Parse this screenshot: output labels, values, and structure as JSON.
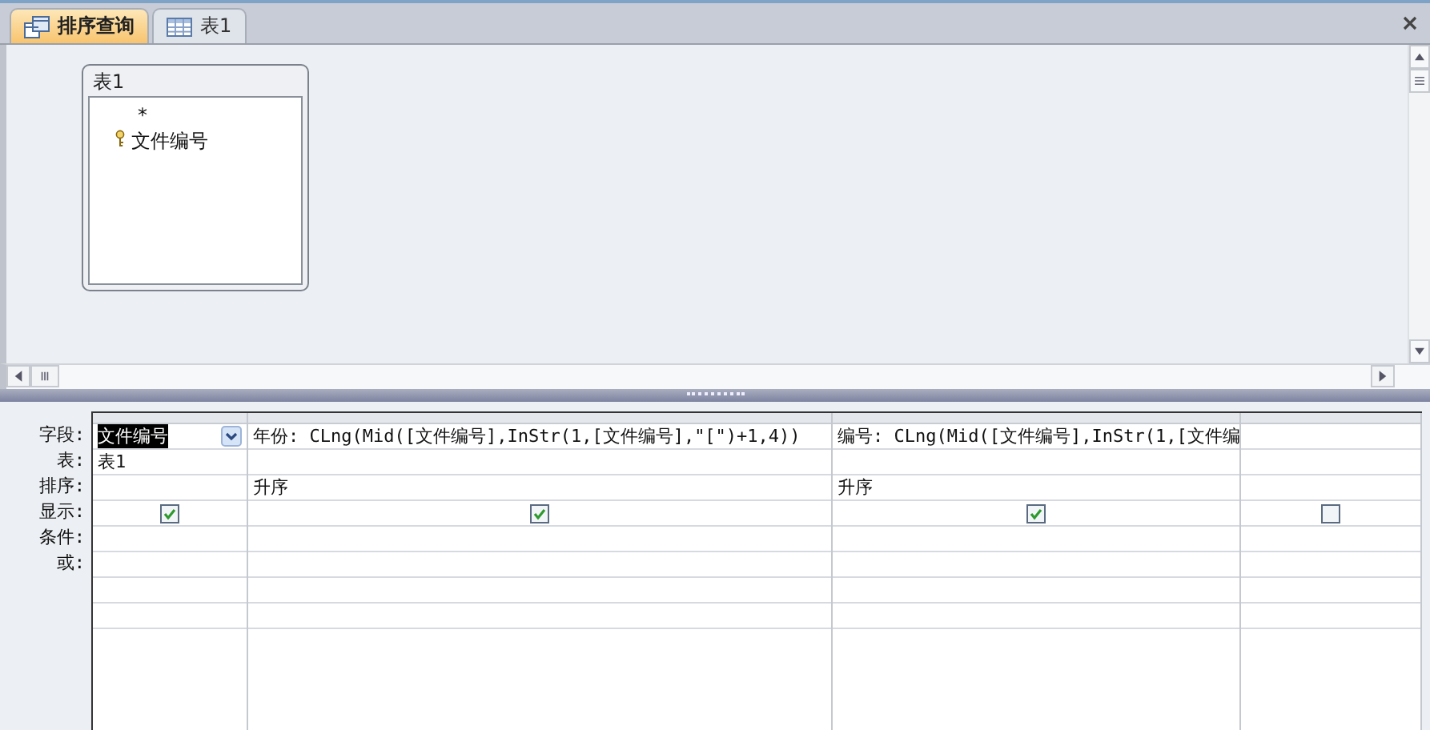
{
  "tabs": [
    {
      "label": "排序查询",
      "kind": "query",
      "selected": true
    },
    {
      "label": "表1",
      "kind": "table",
      "selected": false
    }
  ],
  "table_box": {
    "title": "表1",
    "fields": [
      {
        "name": "*",
        "primary_key": false
      },
      {
        "name": "文件编号",
        "primary_key": true
      }
    ]
  },
  "grid": {
    "row_labels": [
      "字段:",
      "表:",
      "排序:",
      "显示:",
      "条件:",
      "或:"
    ],
    "columns": [
      {
        "field": "文件编号",
        "field_selected": true,
        "table": "表1",
        "show": true
      },
      {
        "field": "年份: CLng(Mid([文件编号],InStr(1,[文件编号],\"[\")+1,4))",
        "field_selected": false,
        "sort": "升序",
        "show": true
      },
      {
        "field": "编号: CLng(Mid([文件编号],InStr(1,[文件编",
        "field_selected": false,
        "sort": "升序",
        "show": true
      },
      {
        "field_selected": false,
        "show": false
      }
    ]
  }
}
